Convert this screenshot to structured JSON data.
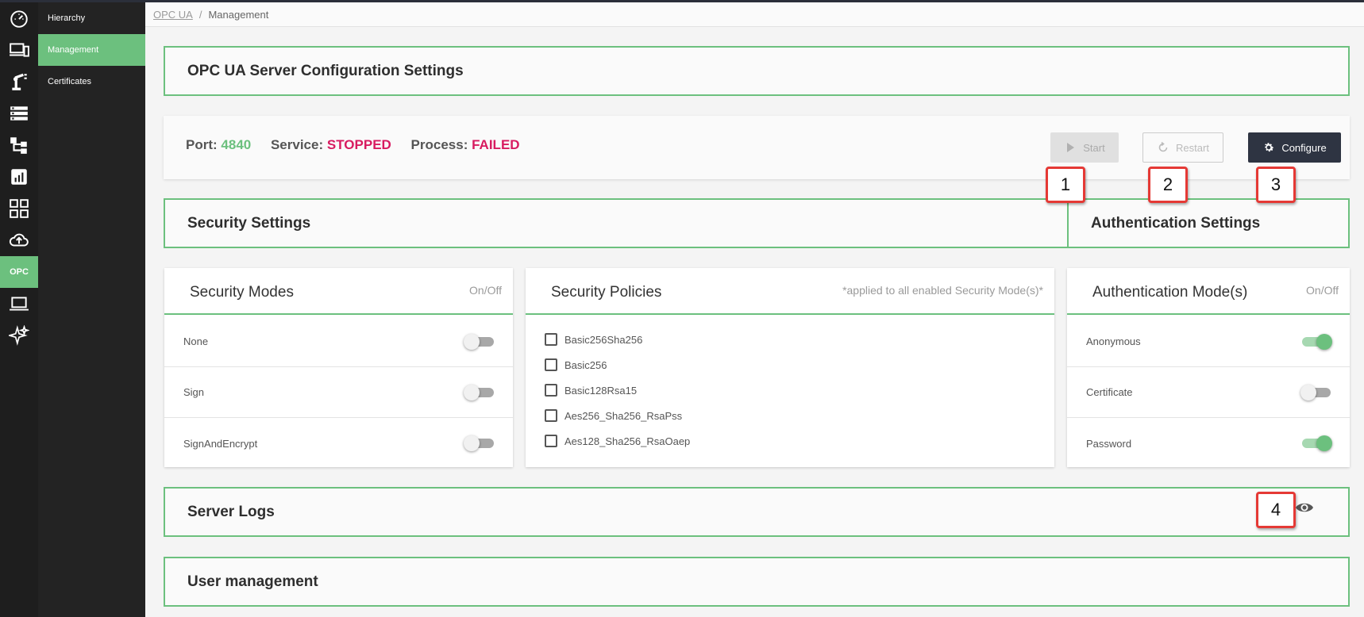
{
  "rail": {
    "items": [
      {
        "icon": "dashboard-icon"
      },
      {
        "icon": "devices-icon"
      },
      {
        "icon": "robot-arm-icon"
      },
      {
        "icon": "server-list-icon"
      },
      {
        "icon": "hierarchy-tree-icon"
      },
      {
        "icon": "analytics-icon"
      },
      {
        "icon": "apps-grid-icon"
      },
      {
        "icon": "cloud-upload-icon"
      },
      {
        "label": "OPC"
      },
      {
        "icon": "laptop-icon"
      },
      {
        "icon": "sparkle-icon"
      }
    ],
    "accent": "#6cc07e"
  },
  "subnav": {
    "items": [
      {
        "label": "Hierarchy"
      },
      {
        "label": "Management"
      },
      {
        "label": "Certificates"
      }
    ]
  },
  "breadcrumb": {
    "root": "OPC UA",
    "separator": "/",
    "current": "Management"
  },
  "header_panel": {
    "title": "OPC UA Server Configuration Settings"
  },
  "status": {
    "port_label": "Port:",
    "port_value": "4840",
    "service_label": "Service:",
    "service_value": "STOPPED",
    "process_label": "Process:",
    "process_value": "FAILED"
  },
  "actions": {
    "start": "Start",
    "restart": "Restart",
    "configure": "Configure"
  },
  "callouts": [
    "1",
    "2",
    "3",
    "4"
  ],
  "security_panel": {
    "title": "Security Settings"
  },
  "auth_panel": {
    "title": "Authentication Settings"
  },
  "security_modes": {
    "title": "Security Modes",
    "aside": "On/Off",
    "modes": [
      {
        "label": "None",
        "enabled": false
      },
      {
        "label": "Sign",
        "enabled": false
      },
      {
        "label": "SignAndEncrypt",
        "enabled": false
      }
    ]
  },
  "security_policies": {
    "title": "Security Policies",
    "aside": "*applied to all enabled Security Mode(s)*",
    "policies": [
      {
        "label": "Basic256Sha256",
        "checked": false
      },
      {
        "label": "Basic256",
        "checked": false
      },
      {
        "label": "Basic128Rsa15",
        "checked": false
      },
      {
        "label": "Aes256_Sha256_RsaPss",
        "checked": false
      },
      {
        "label": "Aes128_Sha256_RsaOaep",
        "checked": false
      }
    ]
  },
  "auth_modes": {
    "title": "Authentication Mode(s)",
    "aside": "On/Off",
    "modes": [
      {
        "label": "Anonymous",
        "enabled": true
      },
      {
        "label": "Certificate",
        "enabled": false
      },
      {
        "label": "Password",
        "enabled": true
      }
    ]
  },
  "server_logs": {
    "title": "Server Logs",
    "icon": "eye-icon"
  },
  "user_management": {
    "title": "User management"
  },
  "colors": {
    "accent": "#6cc07e",
    "error": "#d81b60",
    "dark_button": "#2e3442"
  }
}
